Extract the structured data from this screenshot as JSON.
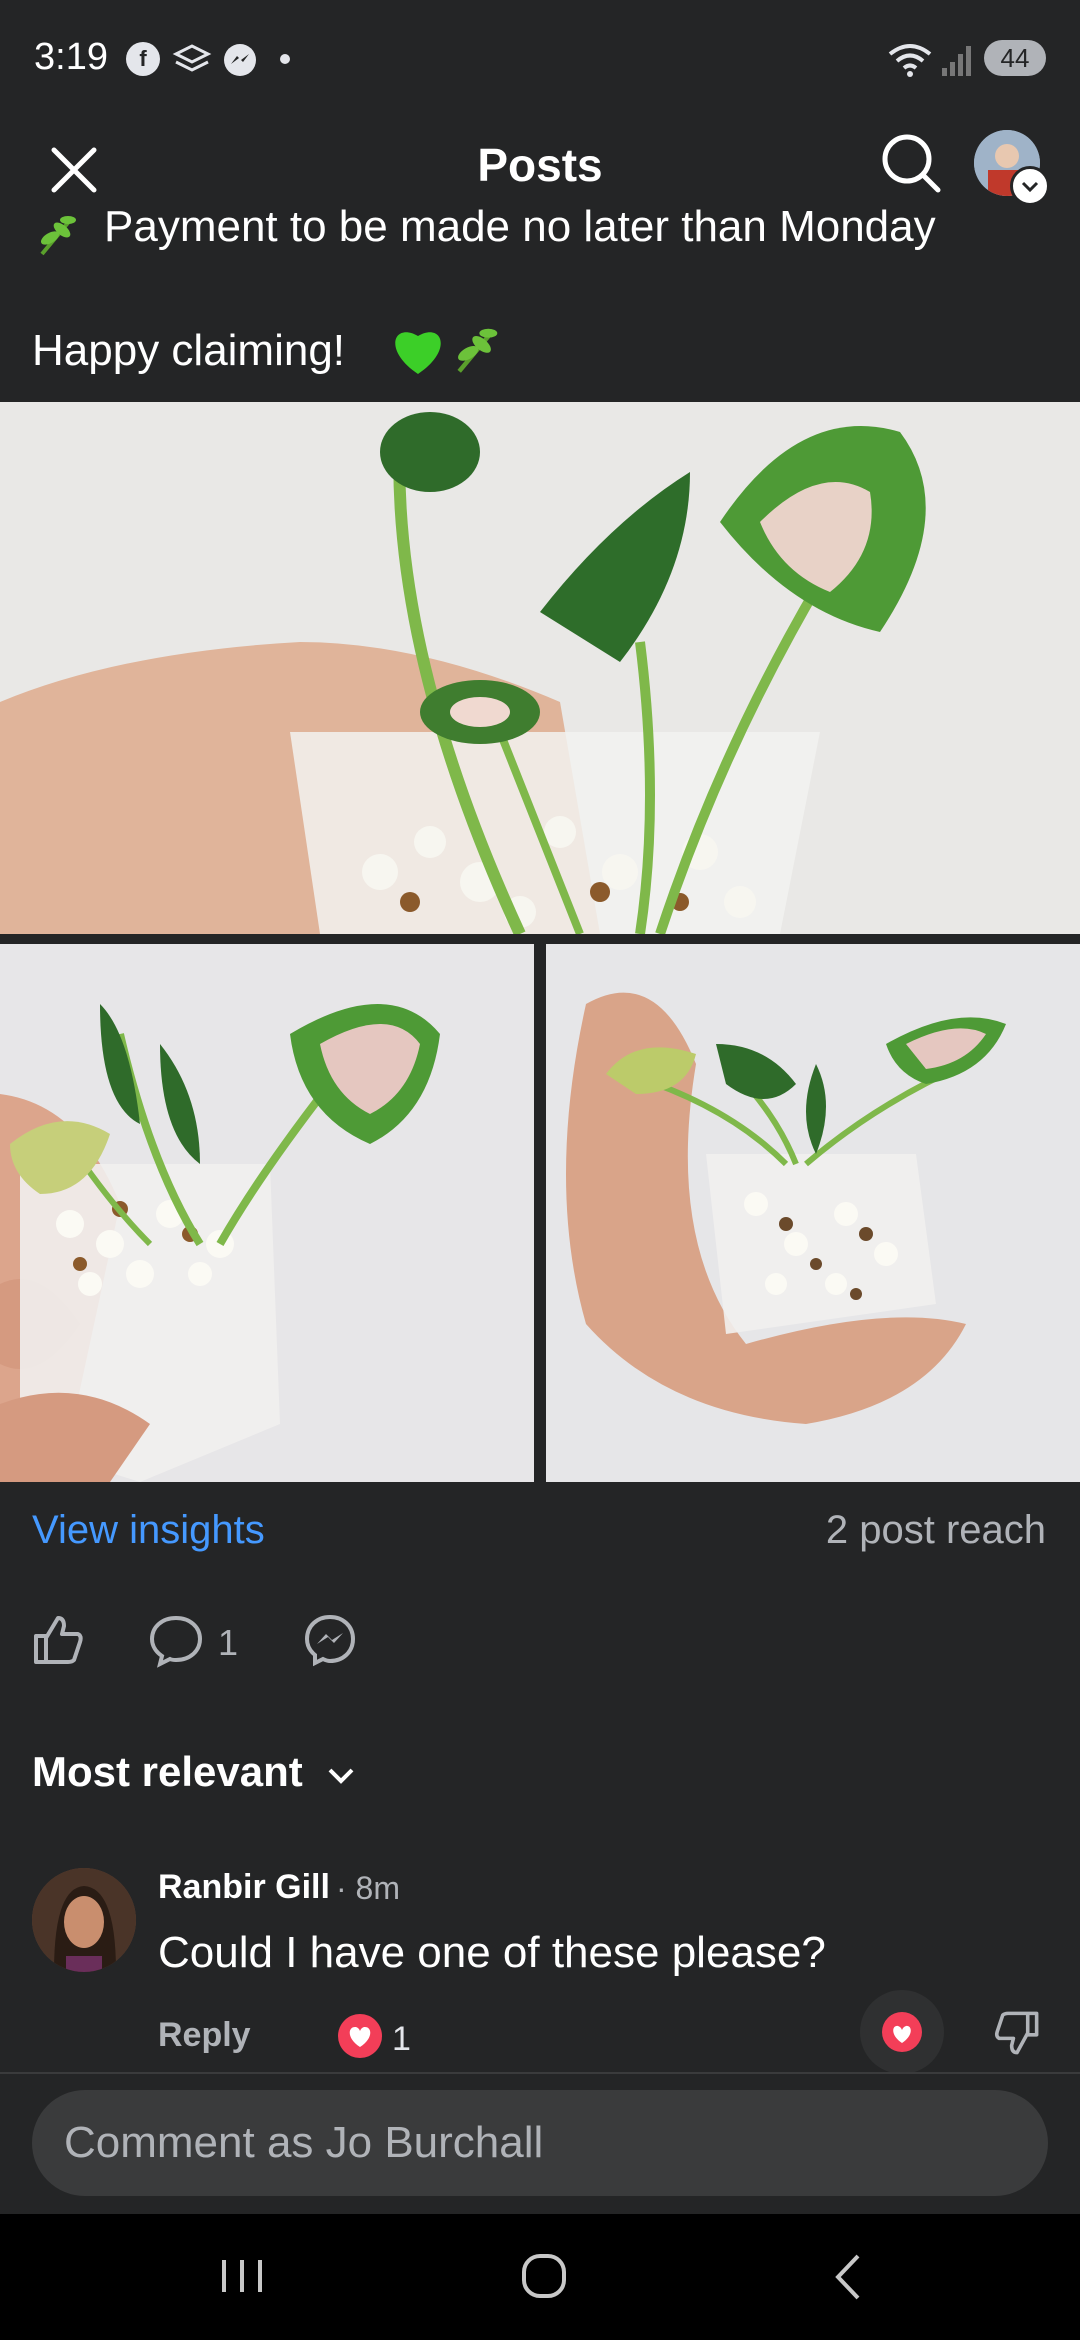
{
  "status_bar": {
    "time": "3:19",
    "battery": "44"
  },
  "header": {
    "title": "Posts"
  },
  "post": {
    "line_payment": "Payment to be made no later than Monday",
    "line_claiming": "Happy claiming!"
  },
  "insights": {
    "link": "View insights",
    "reach": "2 post reach"
  },
  "actions": {
    "comment_count": "1"
  },
  "comments_sort": {
    "label": "Most relevant"
  },
  "comment": {
    "author": "Ranbir Gill",
    "time": "· 8m",
    "text": "Could I have one of these please?",
    "reply_label": "Reply",
    "reaction_count": "1"
  },
  "composer": {
    "placeholder": "Comment as Jo Burchall"
  },
  "colors": {
    "background": "#242526",
    "link": "#4599ff",
    "love": "#f33e58"
  }
}
